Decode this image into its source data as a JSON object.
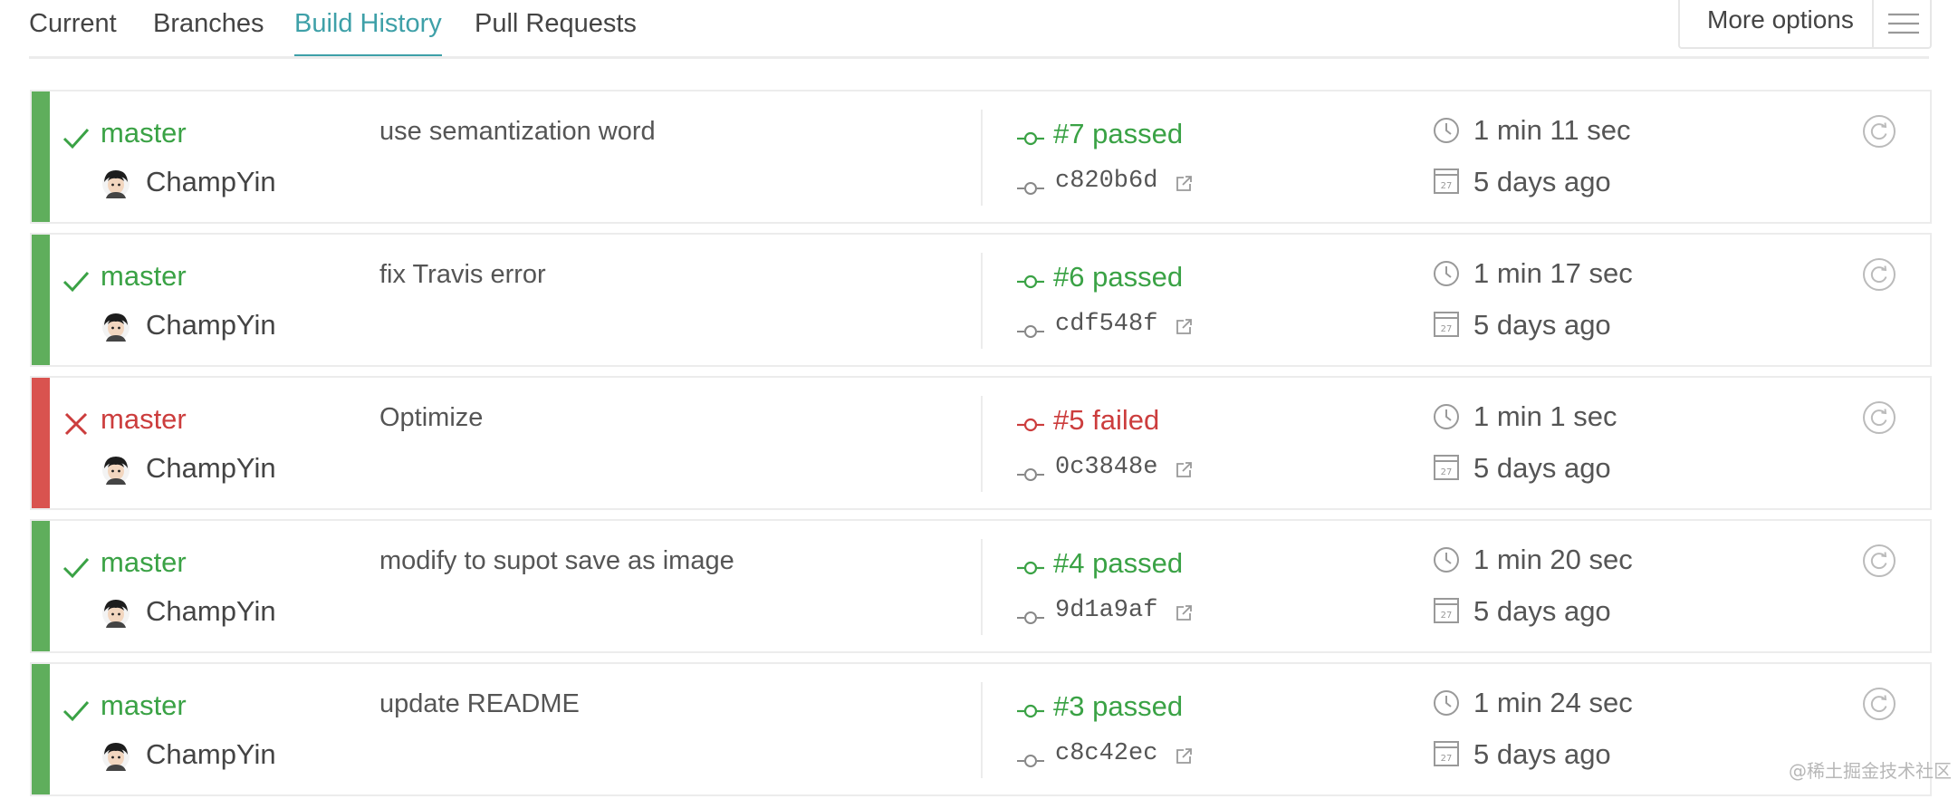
{
  "tabs": [
    {
      "label": "Current",
      "active": false
    },
    {
      "label": "Branches",
      "active": false
    },
    {
      "label": "Build History",
      "active": true
    },
    {
      "label": "Pull Requests",
      "active": false
    }
  ],
  "more_options": {
    "label": "More options",
    "icon": "hamburger-menu-icon"
  },
  "colors": {
    "accent": "#3ea0a8",
    "passed": "#3aa245",
    "passed_stripe": "#5fae5c",
    "failed": "#cc3d3d",
    "failed_stripe": "#d9534f",
    "border": "#ececec"
  },
  "builds": [
    {
      "state": "passed",
      "branch": "master",
      "author": "ChampYin",
      "message": "use semantization word",
      "number_label": "#7 passed",
      "commit": "c820b6d",
      "duration": "1 min 11 sec",
      "finished": "5 days ago"
    },
    {
      "state": "passed",
      "branch": "master",
      "author": "ChampYin",
      "message": "fix Travis error",
      "number_label": "#6 passed",
      "commit": "cdf548f",
      "duration": "1 min 17 sec",
      "finished": "5 days ago"
    },
    {
      "state": "failed",
      "branch": "master",
      "author": "ChampYin",
      "message": "Optimize",
      "number_label": "#5 failed",
      "commit": "0c3848e",
      "duration": "1 min 1 sec",
      "finished": "5 days ago"
    },
    {
      "state": "passed",
      "branch": "master",
      "author": "ChampYin",
      "message": "modify to supot save as image",
      "number_label": "#4 passed",
      "commit": "9d1a9af",
      "duration": "1 min 20 sec",
      "finished": "5 days ago"
    },
    {
      "state": "passed",
      "branch": "master",
      "author": "ChampYin",
      "message": "update README",
      "number_label": "#3 passed",
      "commit": "c8c42ec",
      "duration": "1 min 24 sec",
      "finished": "5 days ago"
    }
  ],
  "calendar_icon_text": "27",
  "watermark": "@稀土掘金技术社区"
}
